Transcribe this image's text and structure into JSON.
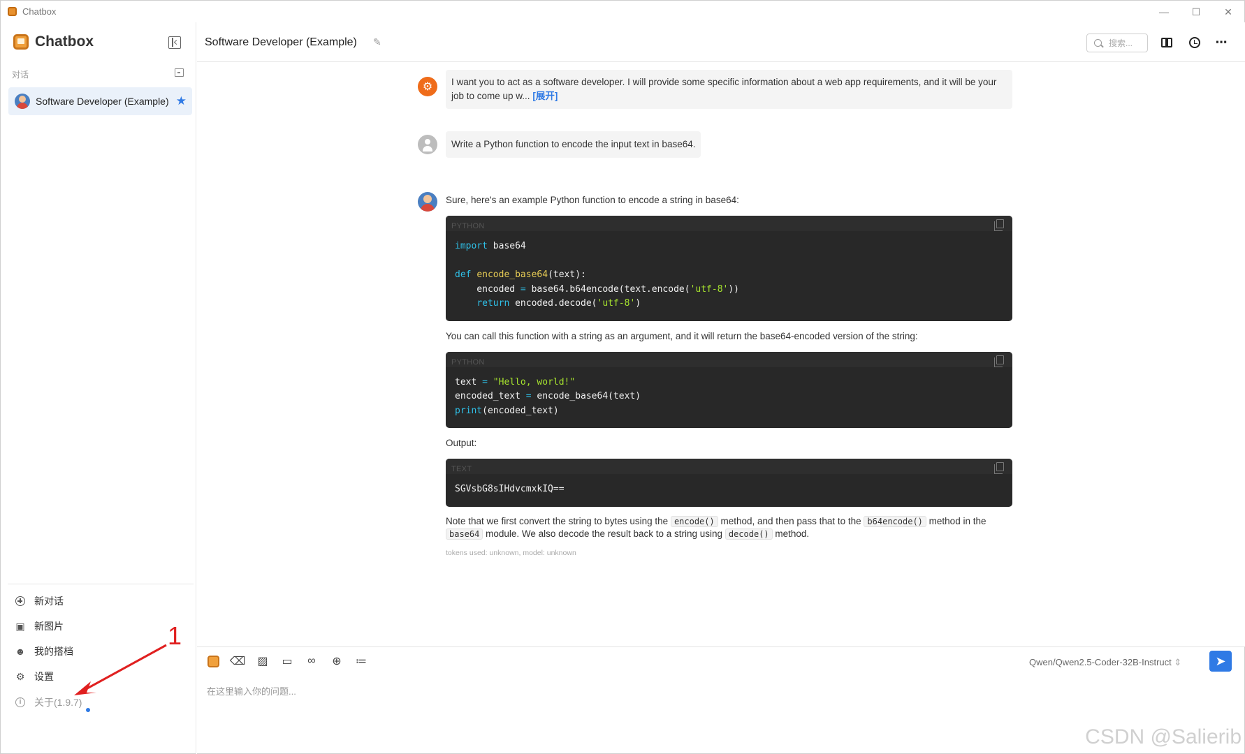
{
  "window": {
    "title": "Chatbox",
    "controls": [
      "minimize-icon",
      "maximize-icon",
      "close-icon"
    ]
  },
  "sidebar": {
    "brand": "Chatbox",
    "section_label": "对话",
    "conversation": {
      "title": "Software Developer (Example)",
      "starred": true
    },
    "menu": [
      {
        "label": "新对话",
        "icon": "circle-plus-icon"
      },
      {
        "label": "新图片",
        "icon": "image-plus-icon"
      },
      {
        "label": "我的搭档",
        "icon": "robot-icon"
      },
      {
        "label": "设置",
        "icon": "gear-icon"
      },
      {
        "label": "关于(1.9.7)",
        "icon": "info-icon",
        "has_update_dot": true
      }
    ]
  },
  "annotation": {
    "number": "1",
    "color": "#e02020"
  },
  "header": {
    "title": "Software Developer (Example)",
    "search_placeholder": "搜索..."
  },
  "messages": {
    "system": {
      "text": "I want you to act as a software developer. I will provide some specific information about a web app requirements, and it will be your job to come up w...",
      "expand_label": "[展开]"
    },
    "user": {
      "text": "Write a Python function to encode the input text in base64."
    },
    "assistant": {
      "intro": "Sure, here's an example Python function to encode a string in base64:",
      "code1_lang": "PYTHON",
      "call_text": "You can call this function with a string as an argument, and it will return the base64-encoded version of the string:",
      "code2_lang": "PYTHON",
      "output_label": "Output:",
      "code3_lang": "TEXT",
      "code3_content": "SGVsbG8sIHdvcmxkIQ==",
      "note_parts": {
        "p1": "Note that we first convert the string to bytes using the",
        "c1": "encode()",
        "p2": "method, and then pass that to the",
        "c2": "b64encode()",
        "p3": "method in the",
        "c3": "base64",
        "p4": "module. We also decode the result back to a string using",
        "c4": "decode()",
        "p5": "method."
      },
      "tokens": "tokens used: unknown, model: unknown"
    }
  },
  "input": {
    "placeholder": "在这里输入你的问题...",
    "model": "Qwen/Qwen2.5-Coder-32B-Instruct",
    "tools": [
      "chatbox-logo-icon",
      "eraser-icon",
      "image-icon",
      "folder-icon",
      "link-icon",
      "globe-icon",
      "sliders-icon"
    ]
  },
  "watermark": "CSDN @Salierib",
  "colors": {
    "accent": "#2f7ae5",
    "system_avatar": "#ef6c1a",
    "code_bg": "#282828"
  }
}
